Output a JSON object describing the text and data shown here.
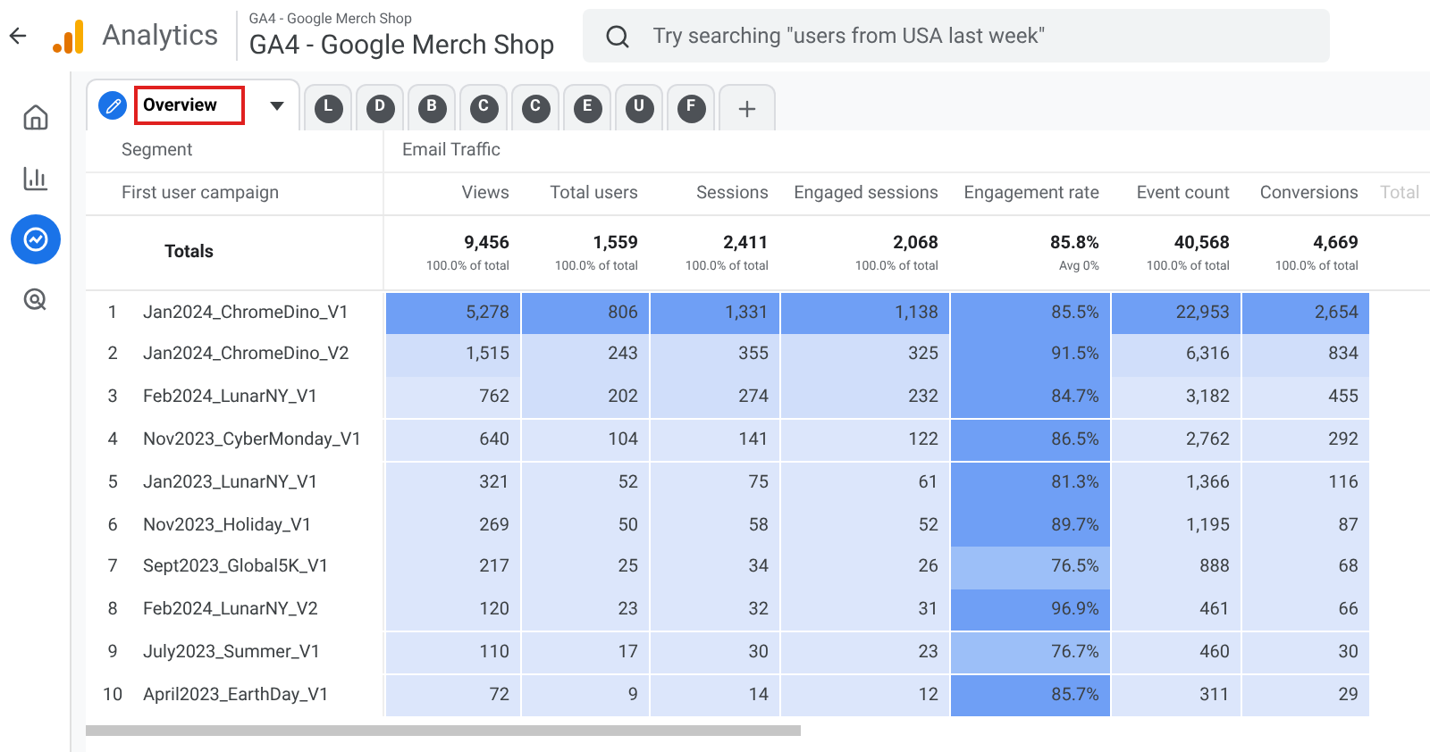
{
  "header": {
    "app_name": "Analytics",
    "property_small": "GA4 - Google Merch Shop",
    "property": "GA4 - Google Merch Shop",
    "search": {
      "placeholder": "Try searching \"users from USA last week\""
    }
  },
  "sidebar": {
    "items": [
      {
        "kind": "home",
        "selected": false
      },
      {
        "kind": "reports",
        "selected": false
      },
      {
        "kind": "explore",
        "selected": true
      },
      {
        "kind": "advertising",
        "selected": false
      }
    ]
  },
  "tabs": [
    {
      "label": "Overview",
      "selected": true
    },
    {
      "label": "L",
      "selected": false
    },
    {
      "label": "D",
      "selected": false
    },
    {
      "label": "B",
      "selected": false
    },
    {
      "label": "C",
      "selected": false
    },
    {
      "label": "C",
      "selected": false
    },
    {
      "label": "E",
      "selected": false
    },
    {
      "label": "U",
      "selected": false
    },
    {
      "label": "F",
      "selected": false
    }
  ],
  "table": {
    "segment_label": "Segment",
    "segment": "Email Traffic",
    "dimension": "First user campaign",
    "columns": [
      "Views",
      "Total users",
      "Sessions",
      "Engaged sessions",
      "Engagement rate",
      "Event count",
      "Conversions",
      "Total"
    ],
    "totals_label": "Totals",
    "totals": [
      {
        "value": "9,456",
        "note": "100.0% of total"
      },
      {
        "value": "1,559",
        "note": "100.0% of total"
      },
      {
        "value": "2,411",
        "note": "100.0% of total"
      },
      {
        "value": "2,068",
        "note": "100.0% of total"
      },
      {
        "value": "85.8%",
        "note": "Avg 0%"
      },
      {
        "value": "40,568",
        "note": "100.0% of total"
      },
      {
        "value": "4,669",
        "note": "100.0% of total"
      }
    ],
    "rows": [
      {
        "index": "1",
        "name": "Jan2024_ChromeDino_V1",
        "cells": [
          {
            "text": "5,278",
            "color": "#6f9ff5"
          },
          {
            "text": "806",
            "color": "#6f9ff5"
          },
          {
            "text": "1,331",
            "color": "#6f9ff5"
          },
          {
            "text": "1,138",
            "color": "#6f9ff5"
          },
          {
            "text": "85.5%",
            "color": "#6f9ff5"
          },
          {
            "text": "22,953",
            "color": "#6f9ff5"
          },
          {
            "text": "2,654",
            "color": "#6f9ff5"
          }
        ]
      },
      {
        "index": "2",
        "name": "Jan2024_ChromeDino_V2",
        "cells": [
          {
            "text": "1,515",
            "color": "#d0defa"
          },
          {
            "text": "243",
            "color": "#d0defa"
          },
          {
            "text": "355",
            "color": "#d0defa"
          },
          {
            "text": "325",
            "color": "#d0defa"
          },
          {
            "text": "91.5%",
            "color": "#6f9ff5"
          },
          {
            "text": "6,316",
            "color": "#d0defa"
          },
          {
            "text": "834",
            "color": "#d0defa"
          }
        ]
      },
      {
        "index": "3",
        "name": "Feb2024_LunarNY_V1",
        "cells": [
          {
            "text": "762",
            "color": "#dce6fb"
          },
          {
            "text": "202",
            "color": "#d0defa"
          },
          {
            "text": "274",
            "color": "#d0defa"
          },
          {
            "text": "232",
            "color": "#d0defa"
          },
          {
            "text": "84.7%",
            "color": "#6f9ff5"
          },
          {
            "text": "3,182",
            "color": "#dce6fb"
          },
          {
            "text": "455",
            "color": "#dce6fb"
          }
        ]
      },
      {
        "index": "4",
        "name": "Nov2023_CyberMonday_V1",
        "cells": [
          {
            "text": "640",
            "color": "#dce6fb"
          },
          {
            "text": "104",
            "color": "#dce6fb"
          },
          {
            "text": "141",
            "color": "#dce6fb"
          },
          {
            "text": "122",
            "color": "#dce6fb"
          },
          {
            "text": "86.5%",
            "color": "#6f9ff5"
          },
          {
            "text": "2,762",
            "color": "#dce6fb"
          },
          {
            "text": "292",
            "color": "#dce6fb"
          }
        ]
      },
      {
        "index": "5",
        "name": "Jan2023_LunarNY_V1",
        "cells": [
          {
            "text": "321",
            "color": "#dce6fb"
          },
          {
            "text": "52",
            "color": "#dce6fb"
          },
          {
            "text": "75",
            "color": "#dce6fb"
          },
          {
            "text": "61",
            "color": "#dce6fb"
          },
          {
            "text": "81.3%",
            "color": "#6f9ff5"
          },
          {
            "text": "1,366",
            "color": "#dce6fb"
          },
          {
            "text": "116",
            "color": "#dce6fb"
          }
        ]
      },
      {
        "index": "6",
        "name": "Nov2023_Holiday_V1",
        "cells": [
          {
            "text": "269",
            "color": "#dce6fb"
          },
          {
            "text": "50",
            "color": "#dce6fb"
          },
          {
            "text": "58",
            "color": "#dce6fb"
          },
          {
            "text": "52",
            "color": "#dce6fb"
          },
          {
            "text": "89.7%",
            "color": "#6f9ff5"
          },
          {
            "text": "1,195",
            "color": "#dce6fb"
          },
          {
            "text": "87",
            "color": "#dce6fb"
          }
        ]
      },
      {
        "index": "7",
        "name": "Sept2023_Global5K_V1",
        "cells": [
          {
            "text": "217",
            "color": "#dce6fb"
          },
          {
            "text": "25",
            "color": "#dce6fb"
          },
          {
            "text": "34",
            "color": "#dce6fb"
          },
          {
            "text": "26",
            "color": "#dce6fb"
          },
          {
            "text": "76.5%",
            "color": "#9cbff8"
          },
          {
            "text": "888",
            "color": "#dce6fb"
          },
          {
            "text": "68",
            "color": "#dce6fb"
          }
        ]
      },
      {
        "index": "8",
        "name": "Feb2024_LunarNY_V2",
        "cells": [
          {
            "text": "120",
            "color": "#dce6fb"
          },
          {
            "text": "23",
            "color": "#dce6fb"
          },
          {
            "text": "32",
            "color": "#dce6fb"
          },
          {
            "text": "31",
            "color": "#dce6fb"
          },
          {
            "text": "96.9%",
            "color": "#6f9ff5"
          },
          {
            "text": "461",
            "color": "#dce6fb"
          },
          {
            "text": "66",
            "color": "#dce6fb"
          }
        ]
      },
      {
        "index": "9",
        "name": "July2023_Summer_V1",
        "cells": [
          {
            "text": "110",
            "color": "#dce6fb"
          },
          {
            "text": "17",
            "color": "#dce6fb"
          },
          {
            "text": "30",
            "color": "#dce6fb"
          },
          {
            "text": "23",
            "color": "#dce6fb"
          },
          {
            "text": "76.7%",
            "color": "#9cbff8"
          },
          {
            "text": "460",
            "color": "#dce6fb"
          },
          {
            "text": "30",
            "color": "#dce6fb"
          }
        ]
      },
      {
        "index": "10",
        "name": "April2023_EarthDay_V1",
        "cells": [
          {
            "text": "72",
            "color": "#dce6fb"
          },
          {
            "text": "9",
            "color": "#dce6fb"
          },
          {
            "text": "14",
            "color": "#dce6fb"
          },
          {
            "text": "12",
            "color": "#dce6fb"
          },
          {
            "text": "85.7%",
            "color": "#6f9ff5"
          },
          {
            "text": "311",
            "color": "#dce6fb"
          },
          {
            "text": "29",
            "color": "#dce6fb"
          }
        ]
      }
    ]
  }
}
